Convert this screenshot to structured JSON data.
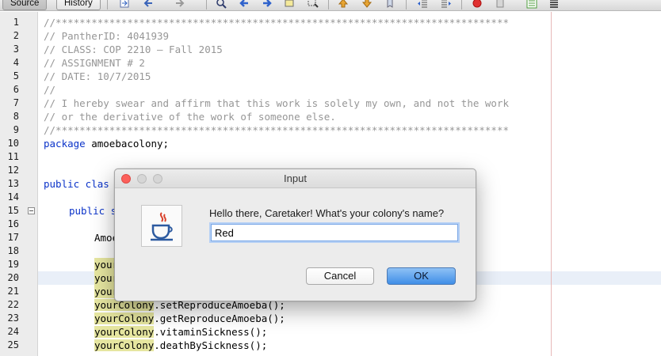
{
  "toolbar": {
    "tabs": [
      {
        "label": "Source",
        "active": true
      },
      {
        "label": "History",
        "active": false
      }
    ],
    "icons": [
      "last-edit-icon",
      "back-icon",
      "forward-icon",
      "find-icon",
      "find-previous-icon",
      "find-next-icon",
      "toggle-highlight-icon",
      "find-selection-icon",
      "previous-bookmark-icon",
      "next-bookmark-icon",
      "toggle-bookmark-icon",
      "shift-left-icon",
      "shift-right-icon",
      "record-macro-icon",
      "stop-macro-icon",
      "comment-icon",
      "uncomment-icon"
    ]
  },
  "editor": {
    "lines": [
      {
        "n": "1",
        "text": "//****************************************************************************"
      },
      {
        "n": "2",
        "text": "// PantherID: 4041939"
      },
      {
        "n": "3",
        "text": "// CLASS: COP 2210 – Fall 2015"
      },
      {
        "n": "4",
        "text": "// ASSIGNMENT # 2"
      },
      {
        "n": "5",
        "text": "// DATE: 10/7/2015"
      },
      {
        "n": "6",
        "text": "//"
      },
      {
        "n": "7",
        "text": "// I hereby swear and affirm that this work is solely my own, and not the work"
      },
      {
        "n": "8",
        "text": "// or the derivative of the work of someone else."
      },
      {
        "n": "9",
        "text": "//****************************************************************************"
      },
      {
        "n": "10",
        "kw": "package",
        "text": " amoebacolony;"
      },
      {
        "n": "11",
        "text": ""
      },
      {
        "n": "12",
        "text": ""
      },
      {
        "n": "13",
        "kw": "public",
        "text": " clas"
      },
      {
        "n": "14",
        "text": ""
      },
      {
        "n": "15",
        "kw": "public",
        "text": " s"
      },
      {
        "n": "16",
        "text": ""
      },
      {
        "n": "17",
        "text": "Amoe"
      },
      {
        "n": "18",
        "text": ""
      },
      {
        "n": "19",
        "text": "your"
      },
      {
        "n": "20",
        "text": "your"
      },
      {
        "n": "21",
        "text": "your"
      },
      {
        "n": "22",
        "mark": "yourColony",
        "text": ".setReproduceAmoeba();"
      },
      {
        "n": "23",
        "mark": "yourColony",
        "text": ".getReproduceAmoeba();"
      },
      {
        "n": "24",
        "mark": "yourColony",
        "text": ".vitaminSickness();"
      },
      {
        "n": "25",
        "mark": "yourColony",
        "text": ".deathBySickness();"
      }
    ]
  },
  "dialog": {
    "title": "Input",
    "prompt": "Hello there, Caretaker! What's your colony's name?",
    "input_value": "Red",
    "cancel_label": "Cancel",
    "ok_label": "OK"
  },
  "colors": {
    "comment": "#969696",
    "keyword": "#0b33c9",
    "mark_highlight": "#e6e6a0",
    "ok_button": "#3f8ee7",
    "close_button": "#fc605b"
  }
}
